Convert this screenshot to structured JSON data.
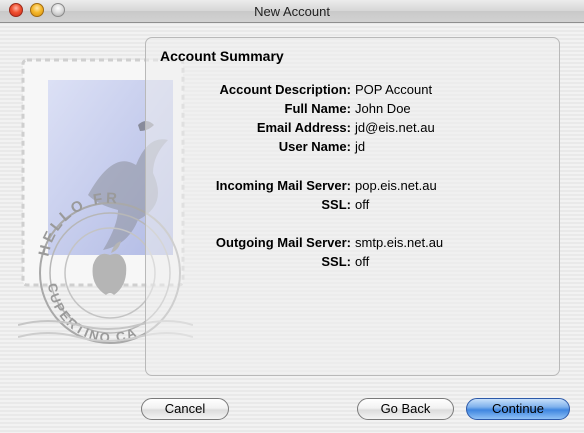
{
  "window": {
    "title": "New Account"
  },
  "stamp": {
    "text_top": "HELLO FR",
    "text_bottom": "CUPERTINO CA"
  },
  "summary": {
    "title": "Account Summary",
    "rows": [
      {
        "label": "Account Description:",
        "value": "POP Account"
      },
      {
        "label": "Full Name:",
        "value": "John Doe"
      },
      {
        "label": "Email Address:",
        "value": "jd@eis.net.au"
      },
      {
        "label": "User Name:",
        "value": "jd"
      },
      {
        "label": "Incoming Mail Server:",
        "value": "pop.eis.net.au"
      },
      {
        "label": "SSL:",
        "value": "off"
      },
      {
        "label": "Outgoing Mail Server:",
        "value": "smtp.eis.net.au"
      },
      {
        "label": "SSL:",
        "value": "off"
      }
    ]
  },
  "buttons": {
    "cancel": "Cancel",
    "back": "Go Back",
    "continue": "Continue"
  }
}
